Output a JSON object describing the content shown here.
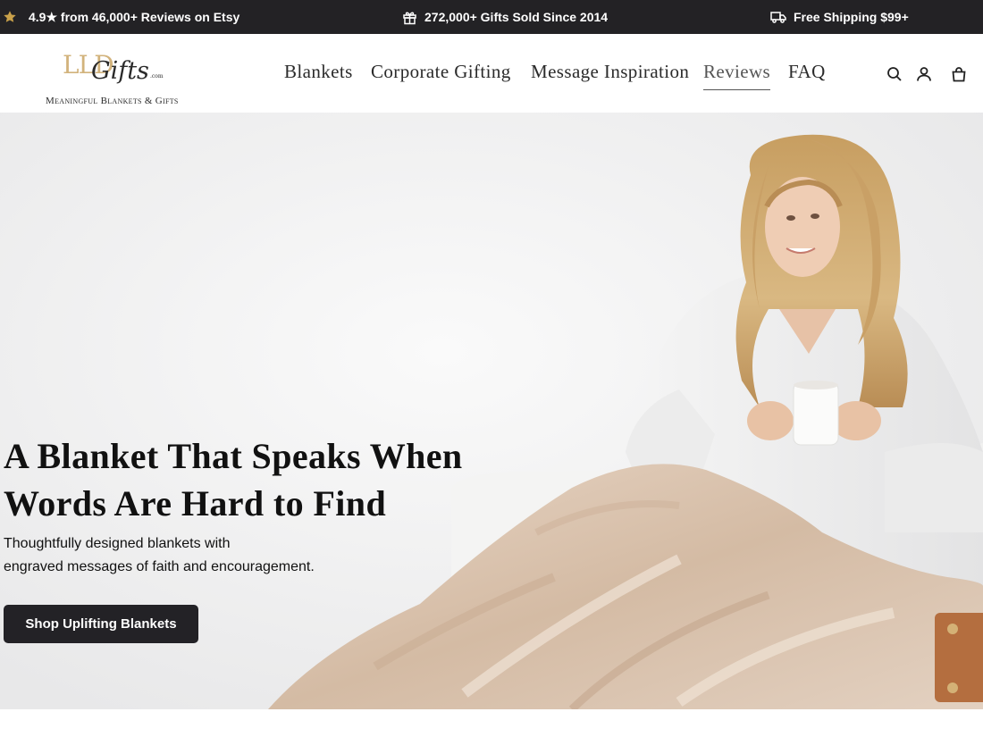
{
  "announcement": {
    "rating_text": "4.9★ from 46,000+ Reviews on Etsy",
    "gifts_text": "272,000+ Gifts Sold Since 2014",
    "shipping_text": "Free Shipping $99+"
  },
  "logo": {
    "mark": "LLD",
    "script": "Gifts",
    "suffix": ".com",
    "tagline": "Meaningful Blankets & Gifts"
  },
  "nav": {
    "items": [
      {
        "label": "Blankets"
      },
      {
        "label": "Corporate Gifting"
      },
      {
        "label": "Message Inspiration"
      },
      {
        "label": "Reviews"
      },
      {
        "label": "FAQ"
      }
    ],
    "active": "Reviews"
  },
  "header_icons": [
    "search-icon",
    "account-icon",
    "cart-icon"
  ],
  "hero": {
    "title": "A Blanket That Speaks When Words Are Hard to Find",
    "subtitle_line1": "Thoughtfully designed blankets with",
    "subtitle_line2": "engraved messages of faith and encouragement.",
    "cta_label": "Shop Uplifting Blankets"
  },
  "colors": {
    "announcement_bg": "#232225",
    "logo_gold": "#d2b37c",
    "button_bg": "#232226",
    "star_gold": "#c9a14a"
  }
}
